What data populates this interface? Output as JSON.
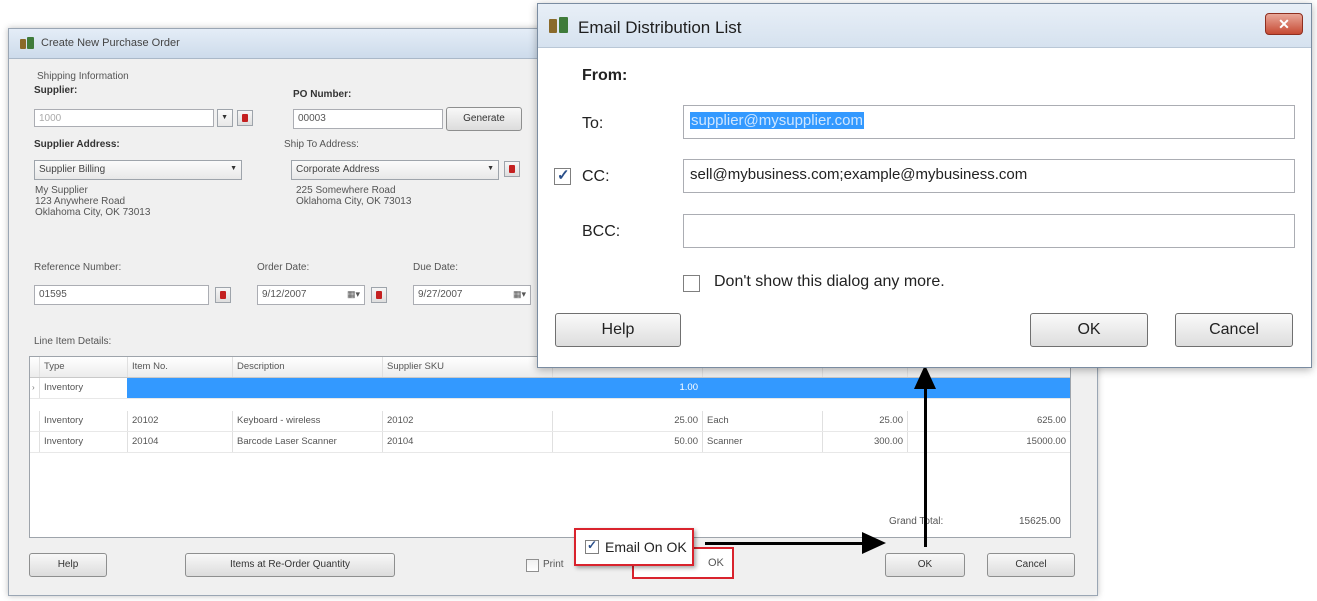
{
  "po_window": {
    "title": "Create New Purchase Order",
    "shipping_info_label": "Shipping Information",
    "supplier_label": "Supplier:",
    "supplier_value": "1000",
    "po_number_label": "PO Number:",
    "po_number_value": "00003",
    "generate_label": "Generate",
    "supplier_address_label": "Supplier Address:",
    "supplier_address_select": "Supplier Billing",
    "supplier_address_text": "My Supplier\n123 Anywhere Road\nOklahoma City, OK 73013",
    "ship_to_label": "Ship To Address:",
    "ship_to_select": "Corporate Address",
    "ship_to_text": "225 Somewhere Road\nOklahoma City, OK 73013",
    "reference_label": "Reference Number:",
    "reference_value": "01595",
    "order_date_label": "Order Date:",
    "order_date_value": "9/12/2007",
    "due_date_label": "Due Date:",
    "due_date_value": "9/27/2007",
    "line_items_label": "Line Item Details:",
    "grid": {
      "columns": [
        "Type",
        "Item No.",
        "Description",
        "Supplier SKU",
        "",
        "",
        "",
        ""
      ],
      "rows": [
        {
          "type": "Inventory",
          "item": "",
          "desc": "",
          "sku": "",
          "qty": "1.00",
          "unit": "",
          "price": "",
          "total": ""
        },
        {
          "type": "Inventory",
          "item": "20102",
          "desc": "Keyboard - wireless",
          "sku": "20102",
          "qty": "25.00",
          "unit": "Each",
          "price": "25.00",
          "total": "625.00"
        },
        {
          "type": "Inventory",
          "item": "20104",
          "desc": "Barcode Laser Scanner",
          "sku": "20104",
          "qty": "50.00",
          "unit": "Scanner",
          "price": "300.00",
          "total": "15000.00"
        }
      ]
    },
    "grand_total_label": "Grand Total:",
    "grand_total_value": "15625.00",
    "help_label": "Help",
    "reorder_label": "Items at Re-Order Quantity",
    "print_label": "Print",
    "ok_label": "OK",
    "cancel_label": "Cancel"
  },
  "email_on_ok": {
    "label": "Email On OK",
    "checked": true,
    "ok_partial": "OK"
  },
  "dialog": {
    "title": "Email Distribution List",
    "from_label": "From:",
    "to_label": "To:",
    "to_value": "supplier@mysupplier.com",
    "cc_label": "CC:",
    "cc_checked": true,
    "cc_value": "sell@mybusiness.com;example@mybusiness.com",
    "bcc_label": "BCC:",
    "bcc_value": "",
    "dont_show_label": "Don't show this dialog any more.",
    "help_label": "Help",
    "ok_label": "OK",
    "cancel_label": "Cancel",
    "close_glyph": "✕"
  },
  "colors": {
    "selection": "#3399ff",
    "callout_red": "#d9232d",
    "close_red": "#c64a33"
  }
}
